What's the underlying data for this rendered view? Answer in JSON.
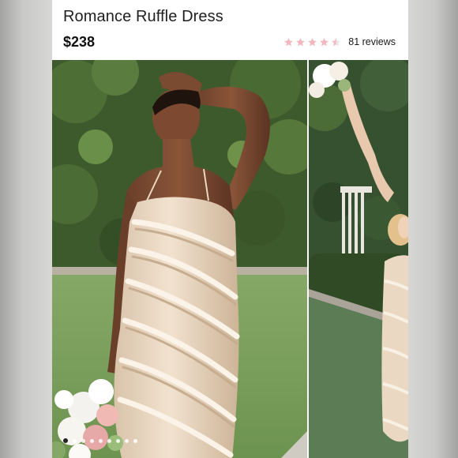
{
  "product": {
    "title": "Romance Ruffle Dress",
    "price": "$238"
  },
  "rating": {
    "stars_filled": 4.5,
    "stars_total": 5,
    "star_color": "#f3b7bf",
    "reviews_label": "81 reviews"
  },
  "gallery": {
    "images": [
      {
        "icon": "photo-model-ruffle-dress-front"
      },
      {
        "icon": "photo-model-holding-bouquet"
      }
    ],
    "dots": 9,
    "active_dot": 0
  },
  "colors": {
    "background": "#d6d6d4",
    "card": "#ffffff",
    "dress": "#ead8c2",
    "foliage": "#3f5a2f",
    "lawn": "#7fa05a"
  }
}
